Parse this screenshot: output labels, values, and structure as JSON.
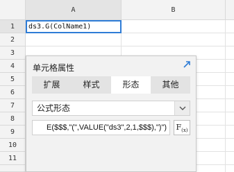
{
  "sheet": {
    "columns": [
      "A",
      "B"
    ],
    "rows": [
      "1",
      "2",
      "3",
      "4",
      "5",
      "6",
      "7",
      "8",
      "9",
      "10",
      "11"
    ],
    "cell_a1": "ds3.G(ColName1)"
  },
  "panel": {
    "title": "单元格属性",
    "tabs": [
      "扩展",
      "样式",
      "形态",
      "其他"
    ],
    "active_tab": "形态",
    "select_value": "公式形态",
    "formula_text": "E($$$,\"(\",VALUE(\"ds3\",2,1,$$$),\")\")",
    "fx_label": "F",
    "fx_sub": "(x)"
  },
  "colors": {
    "accent": "#2e7cd6",
    "panel_bg": "#f2f2f2",
    "tab_bg": "#e3e3e3"
  },
  "icons": {
    "expand": "expand-arrow-icon",
    "dropdown": "chevron-down-icon"
  }
}
